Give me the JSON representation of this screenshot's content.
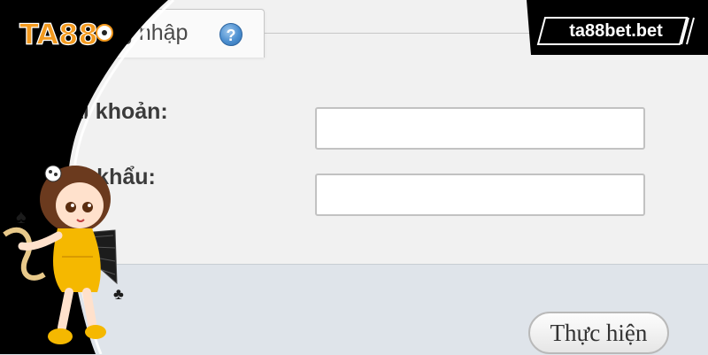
{
  "login_tab": {
    "title": "g nhập",
    "help_icon": "question-icon"
  },
  "form": {
    "account_label": "ài khoản:",
    "password_label": "ật khẩu:",
    "account_value": "",
    "password_value": "",
    "submit_label": "Thực hiện"
  },
  "overlay": {
    "logo_text": "TA88",
    "site_badge": "ta88bet.bet"
  },
  "colors": {
    "overlay_black": "#000000",
    "logo_orange": "#f39a1f",
    "form_bg": "#f1f1f1",
    "footer_bg": "#dfe4ea",
    "mascot_dress": "#f5b800"
  }
}
